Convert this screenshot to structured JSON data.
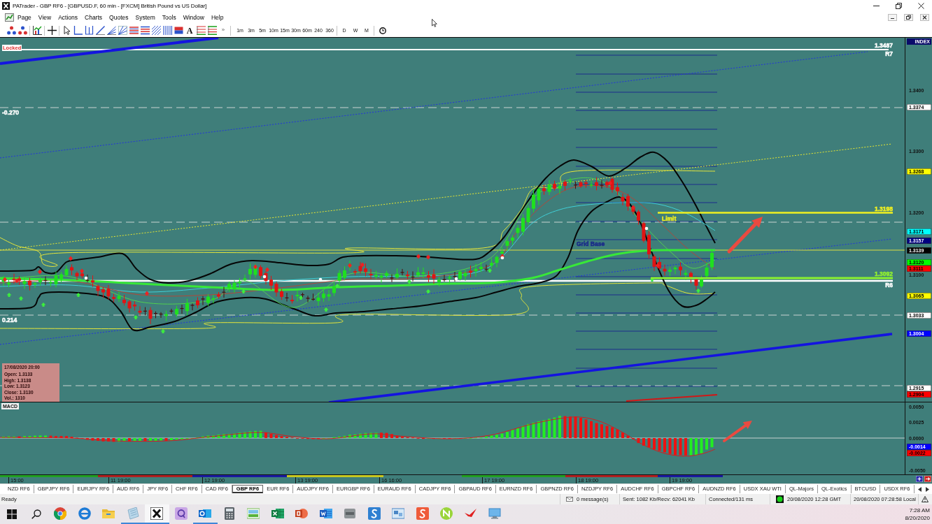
{
  "window": {
    "title": "PATrader - GBP RF6 - [GBPUSD.F, 60 min - [FXCM] British Pound vs US Dollar]"
  },
  "menu": [
    "Page",
    "View",
    "Actions",
    "Charts",
    "Quotes",
    "System",
    "Tools",
    "Window",
    "Help"
  ],
  "toolbar": {
    "text_tool": "A",
    "more": "»",
    "timeframes": [
      "1m",
      "3m",
      "5m",
      "10m",
      "15m",
      "30m",
      "60m",
      "240",
      "360"
    ],
    "periods": [
      "D",
      "W",
      "M"
    ]
  },
  "chart": {
    "labels": [
      {
        "text": "Locked",
        "color": "#e03030",
        "kind": "flag"
      },
      {
        "text": "-0.270",
        "color": "#ffffff",
        "kind": "text"
      },
      {
        "text": "0.214",
        "color": "#ffffff",
        "kind": "text"
      },
      {
        "text": "1.3487",
        "color": "#ffffff",
        "kind": "text"
      },
      {
        "text": "R7",
        "color": "#ffffff",
        "kind": "text"
      },
      {
        "text": "1.3198",
        "color": "#f0f020",
        "kind": "text"
      },
      {
        "text": "Limit",
        "color": "#f0f020",
        "kind": "text"
      },
      {
        "text": "Grid Base",
        "color": "#1a2a8a",
        "kind": "text"
      },
      {
        "text": "1.3092",
        "color": "#90f030",
        "kind": "text"
      },
      {
        "text": "R6",
        "color": "#ffffff",
        "kind": "text"
      }
    ],
    "ohlc_box": {
      "title": "17/08/2020 20:00",
      "lines": [
        "Open: 1.3133",
        "High: 1.3138",
        "Low: 1.3123",
        "Close: 1.3130",
        "Vol.: 1310"
      ]
    }
  },
  "price_axis": {
    "header": "INDEX",
    "labels": [
      {
        "text": "1.3400",
        "kind": "tick"
      },
      {
        "text": "1.3374",
        "kind": "marker",
        "color": "#ffffff"
      },
      {
        "text": "1.3300",
        "kind": "tick"
      },
      {
        "text": "1.3268",
        "kind": "marker",
        "color": "#ffff00"
      },
      {
        "text": "1.3200",
        "kind": "tick"
      },
      {
        "text": "1.3171",
        "kind": "marker",
        "color": "#00ffff"
      },
      {
        "text": "1.3157",
        "kind": "marker",
        "color": "#000080"
      },
      {
        "text": "1.3139",
        "kind": "marker",
        "color": "#000000"
      },
      {
        "text": "1.3120",
        "kind": "marker",
        "color": "#00ff00"
      },
      {
        "text": "1.3111",
        "kind": "marker",
        "color": "#ff0000"
      },
      {
        "text": "1.3100",
        "kind": "tick"
      },
      {
        "text": "1.3065",
        "kind": "marker",
        "color": "#ffff00"
      },
      {
        "text": "1.3033",
        "kind": "marker",
        "color": "#ffffff"
      },
      {
        "text": "1.3004",
        "kind": "marker",
        "color": "#0000ff"
      },
      {
        "text": "1.2915",
        "kind": "marker",
        "color": "#ffffff"
      },
      {
        "text": "1.2904",
        "kind": "marker",
        "color": "#ff0000"
      }
    ]
  },
  "macd": {
    "title": "MACD",
    "axis_labels": [
      {
        "text": "0.0050",
        "kind": "tick"
      },
      {
        "text": "0.0025",
        "kind": "tick"
      },
      {
        "text": "0.0000",
        "kind": "tick"
      },
      {
        "text": "-0.0014",
        "kind": "marker",
        "color": "#0000ff"
      },
      {
        "text": "-0.0022",
        "kind": "marker",
        "color": "#ff0000"
      },
      {
        "text": "-0.0050",
        "kind": "tick"
      }
    ]
  },
  "time_axis": {
    "labels": [
      "15:00",
      "11 19:00",
      "12 19:00",
      "13 19:00",
      "16 16:00",
      "17 19:00",
      "18 19:00",
      "19 19:00"
    ]
  },
  "tabs": [
    {
      "label": "NZD RF6",
      "selected": false
    },
    {
      "label": "GBPJPY RF6",
      "selected": false
    },
    {
      "label": "EURJPY RF6",
      "selected": false
    },
    {
      "label": "AUD RF6",
      "selected": false
    },
    {
      "label": "JPY RF6",
      "selected": false
    },
    {
      "label": "CHF RF6",
      "selected": false
    },
    {
      "label": "CAD RF6",
      "selected": false
    },
    {
      "label": "GBP RF6",
      "selected": true
    },
    {
      "label": "EUR RF6",
      "selected": false
    },
    {
      "label": "AUDJPY RF6",
      "selected": false
    },
    {
      "label": "EURGBP RF6",
      "selected": false
    },
    {
      "label": "EURAUD RF6",
      "selected": false
    },
    {
      "label": "CADJPY RF6",
      "selected": false
    },
    {
      "label": "GBPAUD RF6",
      "selected": false
    },
    {
      "label": "EURNZD RF6",
      "selected": false
    },
    {
      "label": "GBPNZD RF6",
      "selected": false
    },
    {
      "label": "NZDJPY RF6",
      "selected": false
    },
    {
      "label": "AUDCHF RF6",
      "selected": false
    },
    {
      "label": "GBPCHF RF6",
      "selected": false
    },
    {
      "label": "AUDNZD RF6",
      "selected": false
    },
    {
      "label": "USDX XAU WTI",
      "selected": false
    },
    {
      "label": "QL-Majors",
      "selected": false
    },
    {
      "label": "QL-Exotics",
      "selected": false
    },
    {
      "label": "BTCUSD",
      "selected": false
    },
    {
      "label": "USDX RF6",
      "selected": false
    }
  ],
  "status_bar": {
    "ready": "Ready",
    "messages": "0 message(s)",
    "traffic": "Sent: 1082 Kb/Recv: 62041 Kb",
    "connection": "Connected/131 ms",
    "online": true,
    "gmt_time": "20/08/2020 12:28 GMT",
    "local_time": "20/08/2020 07:28:58 Local"
  },
  "taskbar": {
    "apps": [
      {
        "running": false,
        "selected": false
      },
      {
        "running": false,
        "selected": false
      },
      {
        "running": false,
        "selected": false
      },
      {
        "running": true,
        "selected": false
      },
      {
        "running": true,
        "selected": true
      },
      {
        "running": false,
        "selected": false
      },
      {
        "running": true,
        "selected": false
      },
      {
        "running": false,
        "selected": false
      },
      {
        "running": false,
        "selected": false
      },
      {
        "running": false,
        "selected": false
      },
      {
        "running": false,
        "selected": false
      },
      {
        "running": false,
        "selected": false
      },
      {
        "running": false,
        "selected": false
      },
      {
        "running": false,
        "selected": false
      },
      {
        "running": false,
        "selected": false
      },
      {
        "running": false,
        "selected": false
      },
      {
        "running": false,
        "selected": false
      },
      {
        "running": false,
        "selected": false
      },
      {
        "running": false,
        "selected": false
      }
    ],
    "time": "7:28 AM",
    "date": "8/20/2020"
  }
}
